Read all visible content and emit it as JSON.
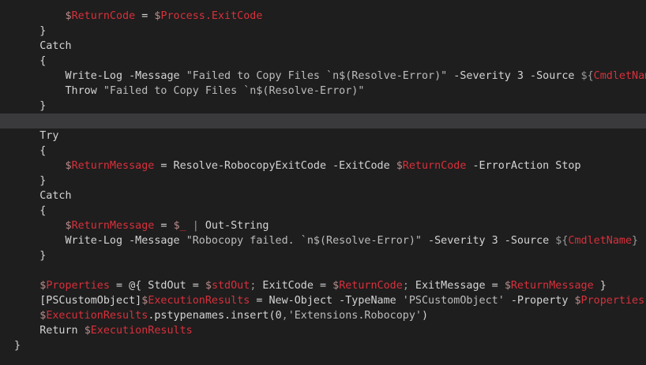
{
  "colors": {
    "background": "#1e1e1e",
    "current_line": "#3a3a3d",
    "default": "#d4d4d4",
    "keyword": "#d4d4d4",
    "variable_dollar": "#b98c8c",
    "variable_name": "#d8303b",
    "string": "#bcbcbc",
    "punctuation": "#9a9a9a",
    "command": "#d4d4d4"
  },
  "editor": {
    "highlighted_line": 7,
    "lines": [
      [
        [
          "v",
          "        $ReturnCode"
        ],
        [
          "d",
          " = "
        ],
        [
          "v",
          "$Process.ExitCode"
        ]
      ],
      [
        [
          "d",
          "    }"
        ]
      ],
      [
        [
          "k",
          "    Catch"
        ]
      ],
      [
        [
          "d",
          "    {"
        ]
      ],
      [
        [
          "c",
          "        Write-Log"
        ],
        [
          "d",
          " -Message "
        ],
        [
          "s",
          "\"Failed to Copy Files `n$(Resolve-Error)\""
        ],
        [
          "d",
          " -Severity 3 -Source "
        ],
        [
          "p",
          "${"
        ],
        [
          "v",
          "CmdletName"
        ],
        [
          "p",
          "}"
        ]
      ],
      [
        [
          "k",
          "        Throw"
        ],
        [
          "d",
          " "
        ],
        [
          "s",
          "\"Failed to Copy Files `n$(Resolve-Error)\""
        ]
      ],
      [
        [
          "d",
          "    }"
        ]
      ],
      [
        [
          "d",
          ""
        ]
      ],
      [
        [
          "k",
          "    Try"
        ]
      ],
      [
        [
          "d",
          "    {"
        ]
      ],
      [
        [
          "v",
          "        $ReturnMessage"
        ],
        [
          "d",
          " = Resolve-RobocopyExitCode -ExitCode "
        ],
        [
          "v",
          "$ReturnCode"
        ],
        [
          "d",
          " -ErrorAction Stop"
        ]
      ],
      [
        [
          "d",
          "    }"
        ]
      ],
      [
        [
          "k",
          "    Catch"
        ]
      ],
      [
        [
          "d",
          "    {"
        ]
      ],
      [
        [
          "v",
          "        $ReturnMessage"
        ],
        [
          "d",
          " = "
        ],
        [
          "v",
          "$_"
        ],
        [
          "d",
          " "
        ],
        [
          "p",
          "|"
        ],
        [
          "d",
          " Out-String"
        ]
      ],
      [
        [
          "c",
          "        Write-Log"
        ],
        [
          "d",
          " -Message "
        ],
        [
          "s",
          "\"Robocopy failed. `n$(Resolve-Error)\""
        ],
        [
          "d",
          " -Severity 3 -Source "
        ],
        [
          "p",
          "${"
        ],
        [
          "v",
          "CmdletName"
        ],
        [
          "p",
          "}"
        ]
      ],
      [
        [
          "d",
          "    }"
        ]
      ],
      [
        [
          "d",
          ""
        ]
      ],
      [
        [
          "v",
          "    $Properties"
        ],
        [
          "d",
          " = @{ StdOut = "
        ],
        [
          "v",
          "$stdOut"
        ],
        [
          "p",
          ";"
        ],
        [
          "d",
          " ExitCode = "
        ],
        [
          "v",
          "$ReturnCode"
        ],
        [
          "p",
          ";"
        ],
        [
          "d",
          " ExitMessage = "
        ],
        [
          "v",
          "$ReturnMessage"
        ],
        [
          "d",
          " }"
        ]
      ],
      [
        [
          "d",
          "    [PSCustomObject]"
        ],
        [
          "v",
          "$ExecutionResults"
        ],
        [
          "d",
          " = New-Object -TypeName "
        ],
        [
          "s",
          "'PSCustomObject'"
        ],
        [
          "d",
          " -Property "
        ],
        [
          "v",
          "$Properties"
        ]
      ],
      [
        [
          "v",
          "    $ExecutionResults"
        ],
        [
          "d",
          ".pstypenames.insert("
        ],
        [
          "d",
          "0"
        ],
        [
          "p",
          ","
        ],
        [
          "s",
          "'Extensions.Robocopy'"
        ],
        [
          "d",
          ")"
        ]
      ],
      [
        [
          "k",
          "    Return"
        ],
        [
          "d",
          " "
        ],
        [
          "v",
          "$ExecutionResults"
        ]
      ],
      [
        [
          "d",
          "}"
        ]
      ]
    ]
  }
}
